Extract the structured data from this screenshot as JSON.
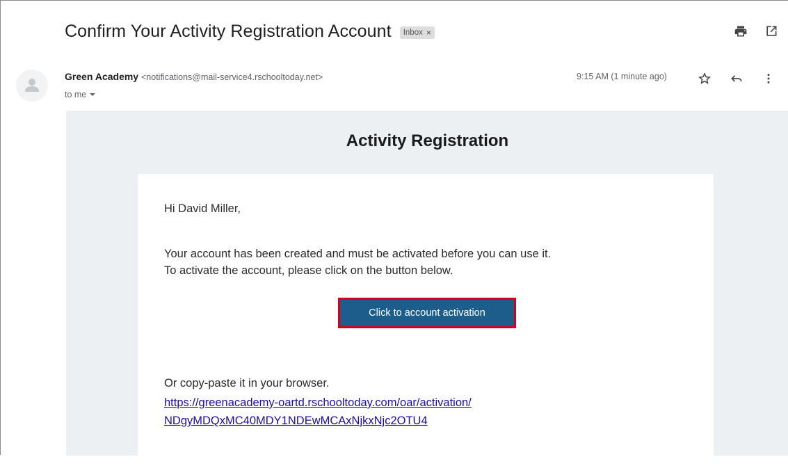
{
  "email": {
    "subject": "Confirm Your Activity Registration Account",
    "label": "Inbox",
    "label_close": "×",
    "sender_name": "Green Academy",
    "sender_email": "<notifications@mail-service4.rschooltoday.net>",
    "recipient": "to me",
    "timestamp": "9:15 AM (1 minute ago)"
  },
  "toolbar": {
    "icons": [
      "print-icon",
      "open-in-new-window-icon",
      "star-icon",
      "reply-icon",
      "more-vert-icon"
    ]
  },
  "body": {
    "title": "Activity Registration",
    "greeting": "Hi David Miller,",
    "line1": "Your account has been created and must be activated before you can use it.",
    "line2": "To activate the account, please click on the button below.",
    "button_label": "Click to account activation",
    "copy_text": "Or copy-paste it in your browser.",
    "link_line1": "https://greenacademy-oartd.rschooltoday.com/oar/activation/",
    "link_line2": "NDgyMDQxMC40MDY1NDEwMCAxNjkxNjc2OTU4"
  },
  "colors": {
    "button_bg": "#1d5d8c",
    "highlight_border": "#d0021b",
    "body_bg": "#edf0f3",
    "link": "#1a0dab"
  }
}
